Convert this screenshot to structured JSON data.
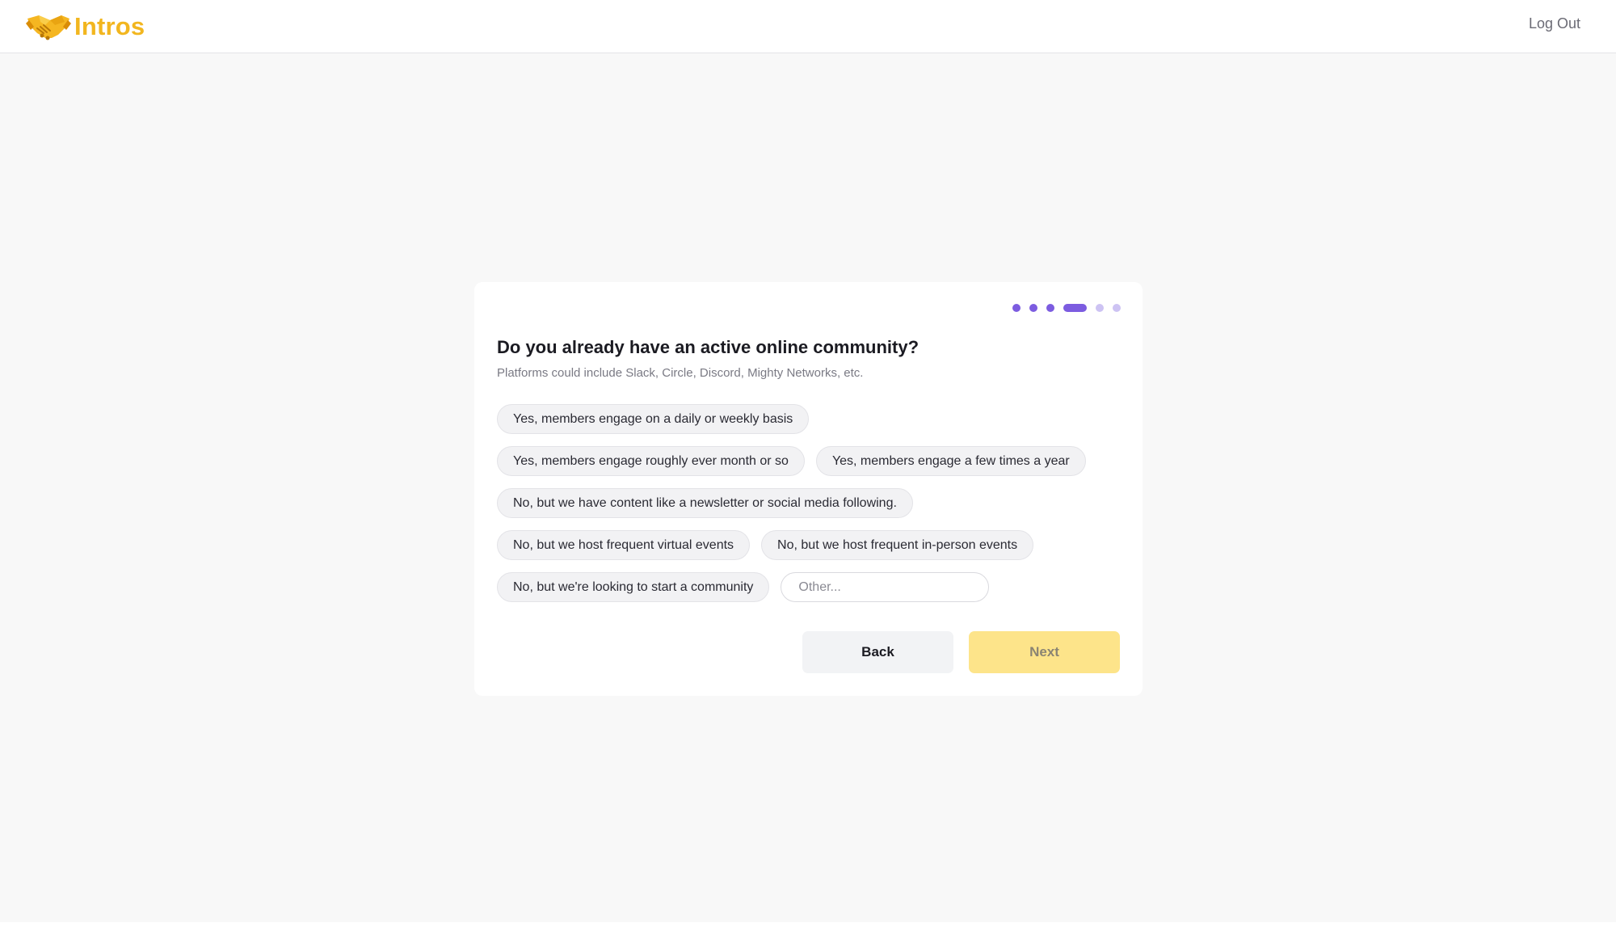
{
  "header": {
    "brand": "Intros",
    "logout_label": "Log Out"
  },
  "progress": {
    "total_steps": 6,
    "current_step": 4
  },
  "question": {
    "title": "Do you already have an active online community?",
    "subtitle": "Platforms could include Slack, Circle, Discord, Mighty Networks, etc."
  },
  "options": [
    "Yes, members engage on a daily or weekly basis",
    "Yes, members engage roughly ever month or so",
    "Yes, members engage a few times a year",
    "No, but we have content like a newsletter or social media following.",
    "No, but we host frequent virtual events",
    "No, but we host frequent in-person events",
    "No, but we're looking to start a community"
  ],
  "other": {
    "placeholder": "Other...",
    "value": ""
  },
  "buttons": {
    "back_label": "Back",
    "next_label": "Next"
  },
  "colors": {
    "brand": "#f2b61f",
    "accent": "#7c5ce0",
    "accent_light": "#cdc3f3",
    "next_button": "#fde48a",
    "page_background": "#f8f8f8"
  },
  "icons": {
    "logo": "handshake-icon"
  }
}
